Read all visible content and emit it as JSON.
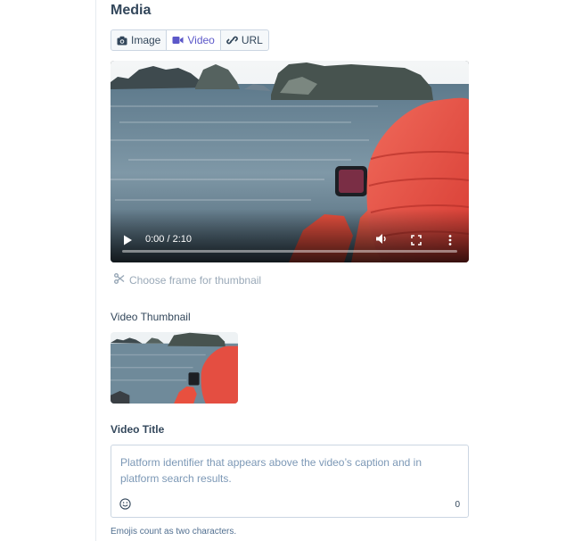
{
  "section": {
    "title": "Media"
  },
  "tabs": [
    {
      "label": "Image",
      "icon": "camera-icon",
      "active": false
    },
    {
      "label": "Video",
      "icon": "video-camera-icon",
      "active": true
    },
    {
      "label": "URL",
      "icon": "link-icon",
      "active": false
    }
  ],
  "video": {
    "time": "0:00 / 2:10",
    "progress": 0,
    "controls": [
      "play-icon",
      "volume-icon",
      "fullscreen-icon",
      "more-options-icon"
    ]
  },
  "choose_frame": {
    "label": "Choose frame for thumbnail",
    "icon": "scissors-icon"
  },
  "thumbnail": {
    "label": "Video Thumbnail"
  },
  "video_title": {
    "label": "Video Title",
    "placeholder": "Platform identifier that appears above the video’s caption and in platform search results.",
    "char_count": "0",
    "emoji_icon": "smiley-icon"
  },
  "help_text": "Emojis count as two characters.",
  "colors": {
    "accent": "#5c58c9",
    "text": "#33475b",
    "border": "#cbd6e2",
    "muted": "#9aa9b8"
  }
}
